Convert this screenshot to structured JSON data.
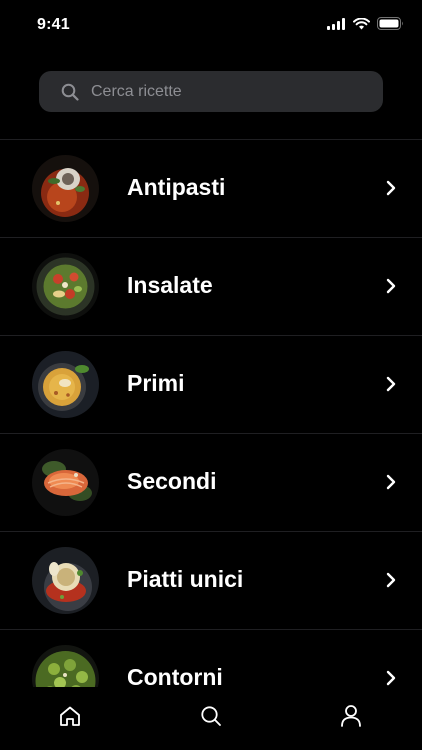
{
  "status_bar": {
    "time": "9:41"
  },
  "search": {
    "placeholder": "Cerca ricette",
    "value": ""
  },
  "categories": [
    {
      "label": "Antipasti"
    },
    {
      "label": "Insalate"
    },
    {
      "label": "Primi"
    },
    {
      "label": "Secondi"
    },
    {
      "label": "Piatti unici"
    },
    {
      "label": "Contorni"
    }
  ],
  "tab_bar": {
    "tabs": [
      "home-icon",
      "search-icon",
      "profile-icon"
    ]
  },
  "colors": {
    "background": "#000000",
    "search_field": "#2b2c2f",
    "placeholder": "#8d8e93",
    "separator": "#1f1f22",
    "text": "#ffffff"
  }
}
